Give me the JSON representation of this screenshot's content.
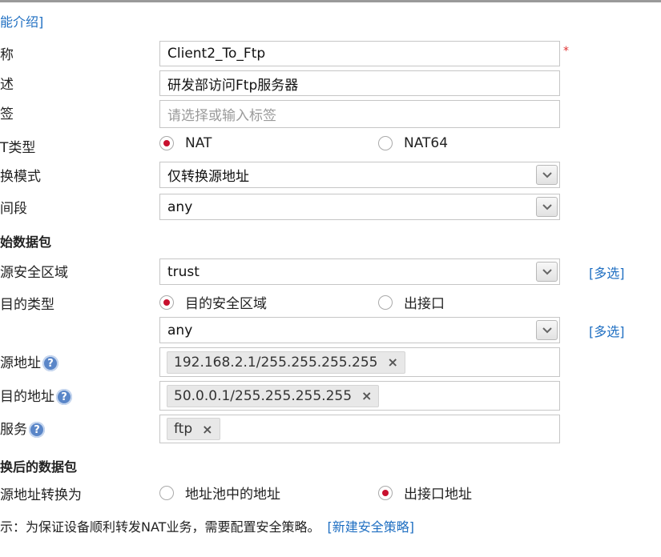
{
  "header": {
    "intro_link": "能介绍]"
  },
  "fields": {
    "name": {
      "label": "称",
      "value": "Client2_To_Ftp",
      "required_mark": "*"
    },
    "desc": {
      "label": "述",
      "value": "研发部访问Ftp服务器"
    },
    "tag": {
      "label": "签",
      "placeholder": "请选择或输入标签"
    },
    "nat_type": {
      "label": "T类型",
      "options": [
        "NAT",
        "NAT64"
      ],
      "selected": "NAT"
    },
    "mode": {
      "label": "换模式",
      "value": "仅转换源地址"
    },
    "time": {
      "label": "间段",
      "value": "any"
    }
  },
  "original_packet": {
    "title": "始数据包",
    "src_zone": {
      "label": "源安全区域",
      "value": "trust",
      "multi_link": "[多选]"
    },
    "dst_type": {
      "label": "目的类型",
      "options": [
        "目的安全区域",
        "出接口"
      ],
      "selected": "目的安全区域"
    },
    "dst_zone": {
      "value": "any",
      "multi_link": "[多选]"
    },
    "src_addr": {
      "label": "源地址",
      "tags": [
        "192.168.2.1/255.255.255.255"
      ]
    },
    "dst_addr": {
      "label": "目的地址",
      "tags": [
        "50.0.0.1/255.255.255.255"
      ]
    },
    "service": {
      "label": "服务",
      "tags": [
        "ftp"
      ]
    }
  },
  "translated_packet": {
    "title": "换后的数据包",
    "src_translate": {
      "label": "源地址转换为",
      "options": [
        "地址池中的地址",
        "出接口地址"
      ],
      "selected": "出接口地址"
    }
  },
  "footer": {
    "tip": "示：为保证设备顺利转发NAT业务，需要配置安全策略。",
    "new_policy_link": "[新建安全策略]"
  },
  "icons": {
    "help": "?",
    "remove": "×"
  },
  "colors": {
    "accent_link": "#1f6fc2",
    "radio_selected": "#c8102e",
    "required": "#e03030"
  }
}
